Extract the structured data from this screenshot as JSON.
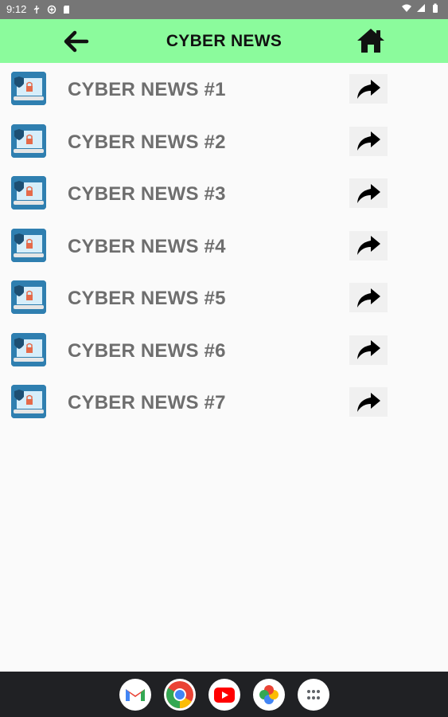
{
  "status_bar": {
    "time": "9:12"
  },
  "app_bar": {
    "title": "CYBER NEWS"
  },
  "news_items": [
    {
      "label": "CYBER NEWS #1"
    },
    {
      "label": "CYBER NEWS #2"
    },
    {
      "label": "CYBER NEWS #3"
    },
    {
      "label": "CYBER NEWS #4"
    },
    {
      "label": "CYBER NEWS #5"
    },
    {
      "label": "CYBER NEWS #6"
    },
    {
      "label": "CYBER NEWS #7"
    }
  ],
  "colors": {
    "app_bar": "#8bfb9c",
    "status_bar": "#767676",
    "nav_bar": "#202124",
    "item_text": "#6e6e6e"
  },
  "dock_apps": [
    "gmail-icon",
    "chrome-icon",
    "youtube-icon",
    "photos-icon",
    "app-drawer-icon"
  ]
}
